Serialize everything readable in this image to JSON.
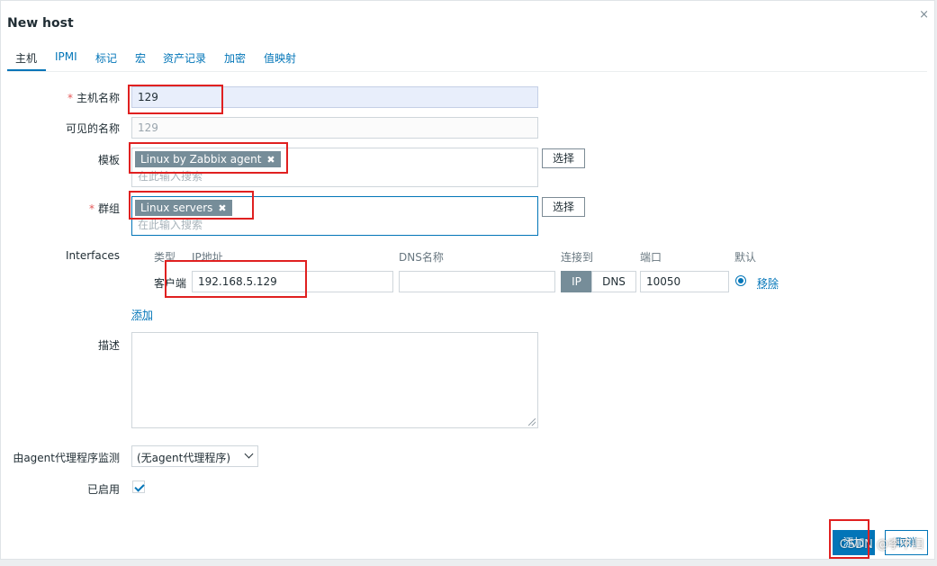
{
  "dialog": {
    "title": "New host",
    "close_icon": "×"
  },
  "tabs": [
    "主机",
    "IPMI",
    "标记",
    "宏",
    "资产记录",
    "加密",
    "值映射"
  ],
  "form": {
    "host_name_label": "主机名称",
    "host_name_value": "129",
    "visible_name_label": "可见的名称",
    "visible_name_placeholder": "129",
    "templates_label": "模板",
    "template_chip": "Linux by Zabbix agent",
    "templates_placeholder": "在此输入搜索",
    "templates_select": "选择",
    "groups_label": "群组",
    "group_chip": "Linux servers",
    "groups_placeholder": "在此输入搜索",
    "groups_select": "选择",
    "interfaces_label": "Interfaces",
    "interfaces_headers": {
      "type": "类型",
      "ip": "IP地址",
      "dns": "DNS名称",
      "connect": "连接到",
      "port": "端口",
      "default": "默认"
    },
    "interface_row": {
      "type": "客户端",
      "ip": "192.168.5.129",
      "dns": "",
      "ip_btn": "IP",
      "dns_btn": "DNS",
      "port": "10050",
      "remove": "移除"
    },
    "add_link": "添加",
    "description_label": "描述",
    "description_value": "",
    "proxy_label": "由agent代理程序监测",
    "proxy_value": "(无agent代理程序)",
    "enabled_label": "已启用",
    "enabled_checked": true
  },
  "footer": {
    "add_button": "添加",
    "cancel_button": "取消"
  },
  "watermark": "CSDN @李不归",
  "colors": {
    "accent": "#0275b8",
    "chip": "#768d99",
    "annotation": "#e02020"
  }
}
